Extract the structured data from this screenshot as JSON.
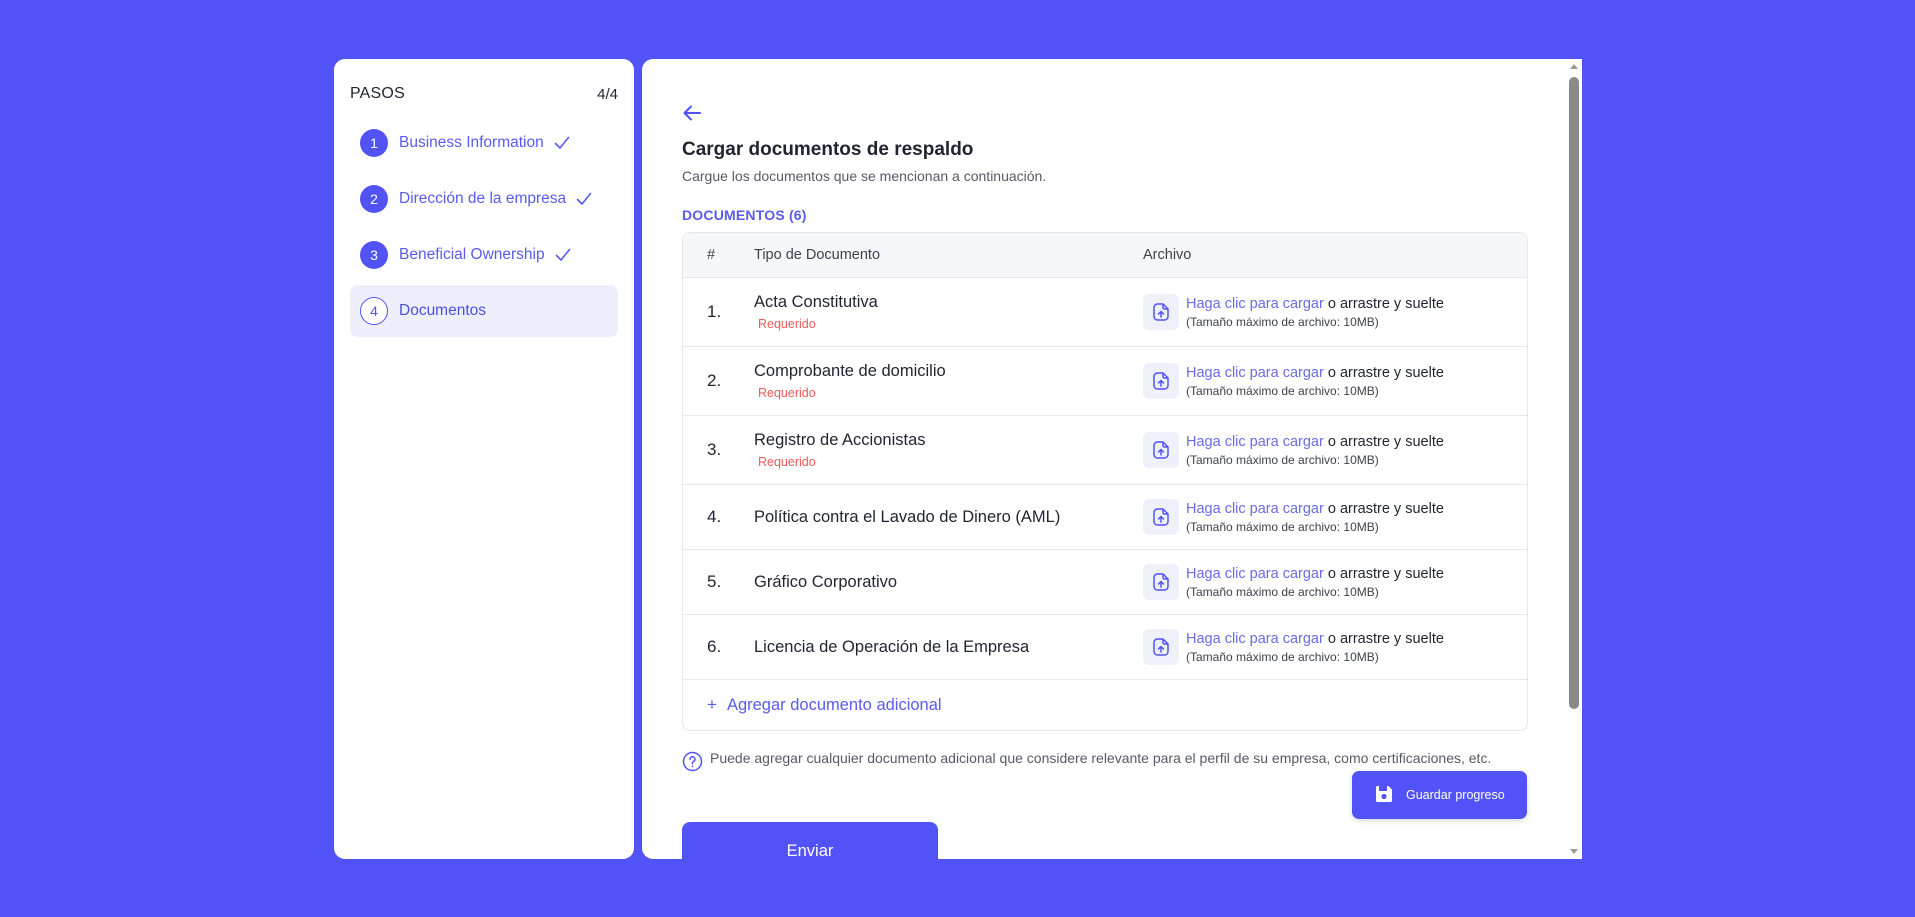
{
  "sidebar": {
    "title": "PASOS",
    "count": "4/4",
    "steps": [
      {
        "num": "1",
        "label": "Business Information"
      },
      {
        "num": "2",
        "label": "Dirección de la empresa"
      },
      {
        "num": "3",
        "label": "Beneficial Ownership"
      },
      {
        "num": "4",
        "label": "Documentos"
      }
    ]
  },
  "main": {
    "title": "Cargar documentos de respaldo",
    "subtitle": "Cargue los documentos que se mencionan a continuación.",
    "docs_label": "DOCUMENTOS (6)",
    "table": {
      "headers": [
        "#",
        "Tipo de Documento",
        "Archivo"
      ],
      "rows": [
        {
          "num": "1.",
          "name": "Acta Constitutiva",
          "required": "Requerido"
        },
        {
          "num": "2.",
          "name": "Comprobante de domicilio",
          "required": "Requerido"
        },
        {
          "num": "3.",
          "name": "Registro de Accionistas",
          "required": "Requerido"
        },
        {
          "num": "4.",
          "name": "Política contra el Lavado de Dinero (AML)"
        },
        {
          "num": "5.",
          "name": "Gráfico Corporativo"
        },
        {
          "num": "6.",
          "name": "Licencia de Operación de la Empresa"
        }
      ],
      "upload": {
        "link": "Haga clic para cargar",
        "rest": " o arrastre y suelte",
        "max": "(Tamaño máximo de archivo: 10MB)"
      }
    },
    "add_label": "Agregar documento adicional",
    "add_plus": "+",
    "hint": "Puede agregar cualquier documento adicional que considere relevante para el perfil de su empresa, como certificaciones, etc.",
    "submit_label": "Enviar",
    "save_label": "Guardar progreso"
  },
  "colors": {
    "accent": "#5253f7",
    "required": "#ef5a5a",
    "link": "#6a6be8"
  },
  "icons": [
    "check-icon",
    "arrow-left-icon",
    "file-upload-icon",
    "help-circle-icon",
    "save-icon"
  ]
}
